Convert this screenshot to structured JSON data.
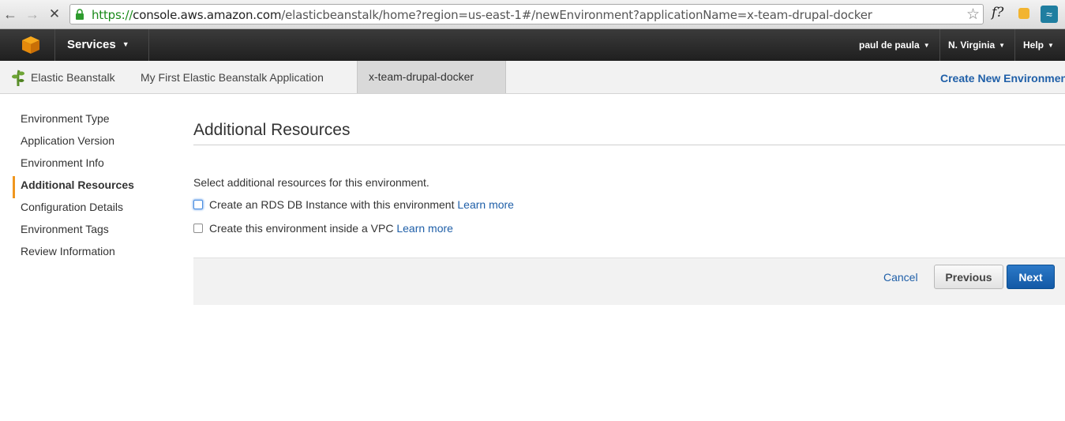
{
  "browser": {
    "url_scheme": "https://",
    "url_host": "console.aws.amazon.com",
    "url_path": "/elasticbeanstalk/home?region=us-east-1#/newEnvironment?applicationName=x-team-drupal-docker",
    "ext_f_label": "f?",
    "icons": [
      "back-arrow-icon",
      "forward-arrow-icon",
      "stop-loading-icon",
      "lock-icon",
      "bookmark-star-icon"
    ]
  },
  "header": {
    "services_label": "Services",
    "user_label": "paul de paula",
    "region_label": "N. Virginia",
    "help_label": "Help"
  },
  "breadcrumb": {
    "service": "Elastic Beanstalk",
    "application": "My First Elastic Beanstalk Application",
    "environment": "x-team-drupal-docker",
    "create_new": "Create New Environment"
  },
  "sidebar": {
    "items": [
      {
        "label": "Environment Type",
        "active": false
      },
      {
        "label": "Application Version",
        "active": false
      },
      {
        "label": "Environment Info",
        "active": false
      },
      {
        "label": "Additional Resources",
        "active": true
      },
      {
        "label": "Configuration Details",
        "active": false
      },
      {
        "label": "Environment Tags",
        "active": false
      },
      {
        "label": "Review Information",
        "active": false
      }
    ]
  },
  "main": {
    "title": "Additional Resources",
    "description": "Select additional resources for this environment.",
    "options": [
      {
        "label": "Create an RDS DB Instance with this environment",
        "link": "Learn more",
        "checked": false
      },
      {
        "label": "Create this environment inside a VPC",
        "link": "Learn more",
        "checked": false
      }
    ],
    "cancel_label": "Cancel",
    "previous_label": "Previous",
    "next_label": "Next"
  },
  "colors": {
    "accent_orange": "#f0961e",
    "link_blue": "#1f5fa8",
    "primary_button": "#1259a6",
    "header_dark": "#232323"
  }
}
